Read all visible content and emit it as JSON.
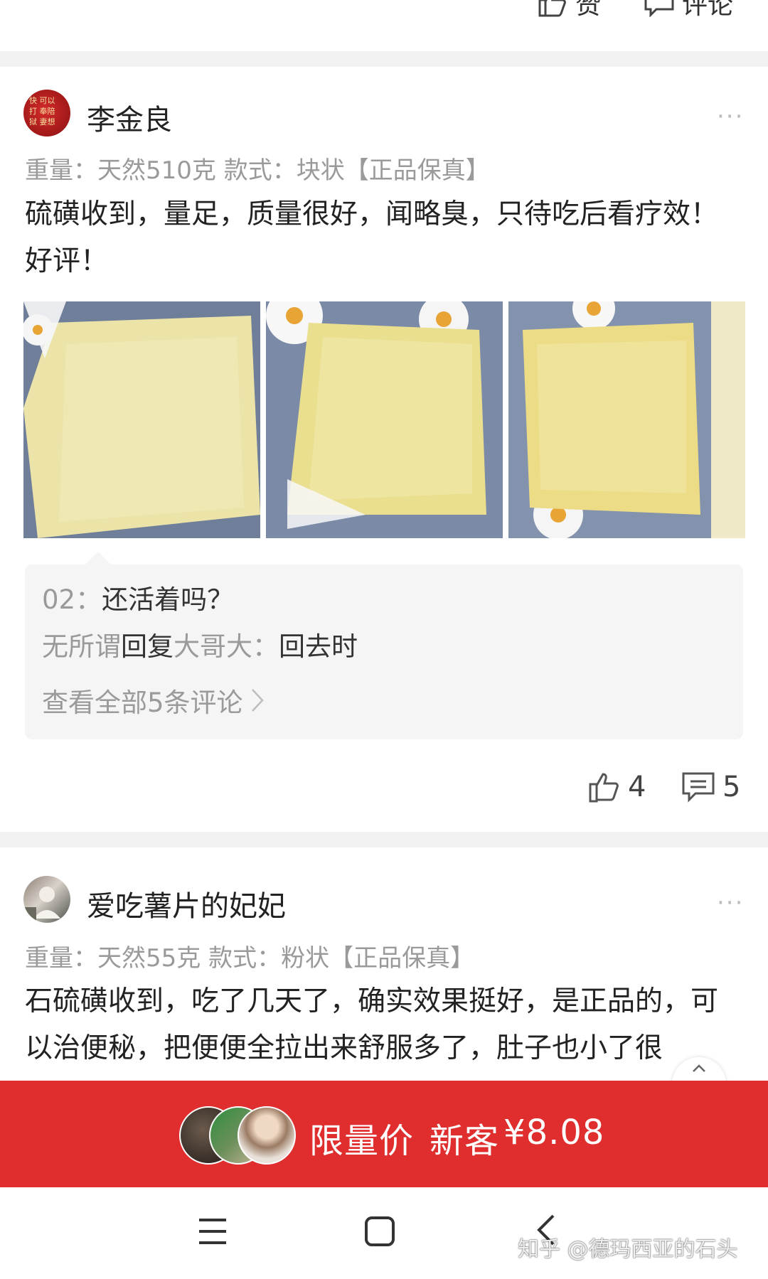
{
  "top_actions": {
    "like_label": "赞",
    "comment_label": "评论"
  },
  "reviews": [
    {
      "user": "李金良",
      "avatar_text": "快 可以 打 奉陪 狱 妻想",
      "more": "···",
      "meta": "重量：天然510克   款式：块状【正品保真】",
      "text": "硫磺收到，量足，质量很好，闻略臭，只待吃后看疗效！好评！",
      "photos": [
        "photo-1",
        "photo-2",
        "photo-3"
      ],
      "replies": [
        {
          "name": "02：",
          "text": "还活着吗？"
        },
        {
          "name": "无所谓",
          "text": "回复",
          "name2": "大哥大：",
          "text2": "回去时"
        }
      ],
      "view_all": "查看全部5条评论",
      "likes": "4",
      "comments": "5"
    },
    {
      "user": "爱吃薯片的妃妃",
      "more": "···",
      "meta": "重量：天然55克   款式：粉状【正品保真】",
      "text": "石硫磺收到，吃了几天了，确实效果挺好，是正品的，可以治便秘，把便便全拉出来舒服多了，肚子也小了很"
    }
  ],
  "promo": {
    "label": "限量价",
    "sublabel": "新客",
    "price": "¥8.08"
  },
  "nav": {
    "menu": "menu-icon",
    "home": "home-icon",
    "back": "back-icon"
  },
  "watermark": "知乎 @德玛西亚的石头",
  "colors": {
    "accent": "#e02d2d",
    "bg_sep": "#f2f2f2",
    "meta": "#9a9a9a"
  }
}
